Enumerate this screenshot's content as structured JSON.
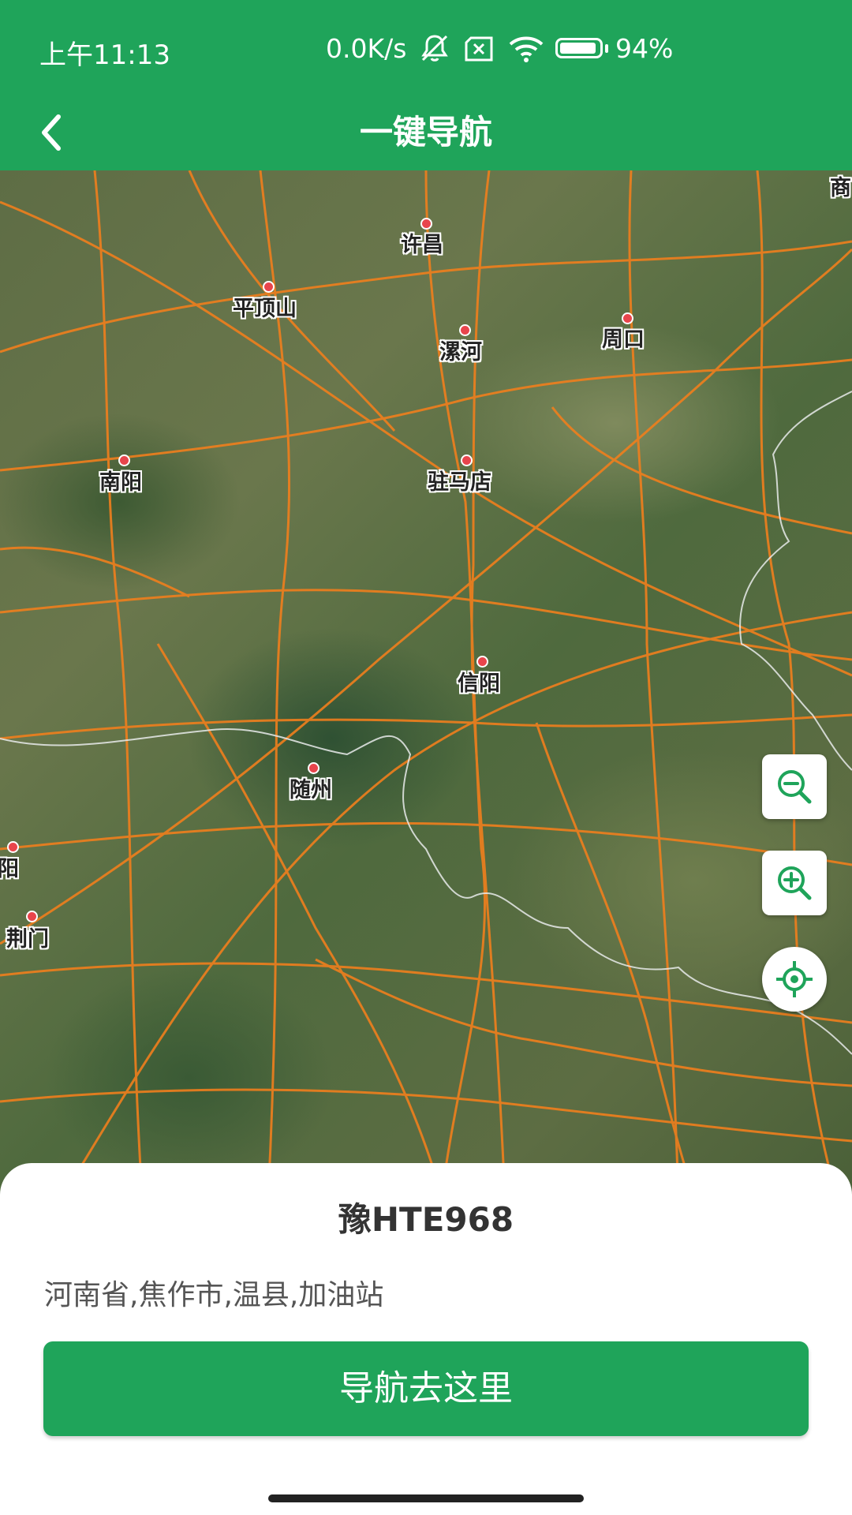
{
  "status_bar": {
    "time": "上午11:13",
    "network_speed": "0.0K/s",
    "battery_percent": "94%",
    "battery_level": 0.94,
    "icons": [
      "mute-icon",
      "sim-off-icon",
      "wifi-icon",
      "battery-icon"
    ]
  },
  "header": {
    "title": "一键导航",
    "back_icon": "chevron-left-icon"
  },
  "map": {
    "cities": [
      "许昌",
      "平顶山",
      "漯河",
      "周口",
      "南阳",
      "驻马店",
      "信阳",
      "襄阳",
      "随州",
      "荆门",
      "商"
    ],
    "controls": [
      "zoom-out-icon",
      "zoom-in-icon",
      "locate-icon"
    ]
  },
  "bottom_sheet": {
    "plate_number": "豫HTE968",
    "address": "河南省,焦作市,温县,加油站",
    "navigate_button": "导航去这里"
  },
  "colors": {
    "primary": "#1fa45a",
    "road": "#f07f1d",
    "city_dot": "#e8454c"
  }
}
